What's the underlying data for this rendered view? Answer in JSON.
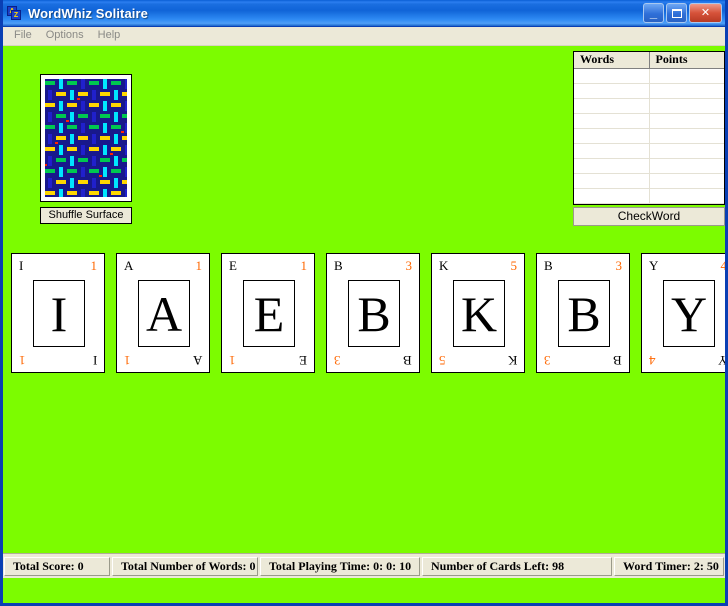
{
  "window": {
    "title": "WordWhiz Solitaire",
    "app_icon": "az-sort-icon",
    "icon_letter_top": "A",
    "icon_letter_bottom": "Z",
    "minimize_label": "_",
    "maximize_label": "",
    "close_label": "✕",
    "background_color": "#7cfc00",
    "titlebar_color": "#1064d8"
  },
  "menu": {
    "items": [
      {
        "label": "File"
      },
      {
        "label": "Options"
      },
      {
        "label": "Help"
      }
    ]
  },
  "deck": {
    "shuffle_label": "Shuffle Surface",
    "back_colors": [
      "#18188c",
      "#ffd700",
      "#00c850",
      "#00e5ff",
      "#2020cc",
      "#ff2200"
    ]
  },
  "wordlist": {
    "columns": [
      "Words",
      "Points"
    ],
    "rows": [
      {
        "word": "",
        "points": ""
      },
      {
        "word": "",
        "points": ""
      },
      {
        "word": "",
        "points": ""
      },
      {
        "word": "",
        "points": ""
      },
      {
        "word": "",
        "points": ""
      },
      {
        "word": "",
        "points": ""
      },
      {
        "word": "",
        "points": ""
      },
      {
        "word": "",
        "points": ""
      },
      {
        "word": "",
        "points": ""
      }
    ],
    "check_label": "CheckWord"
  },
  "cards": [
    {
      "letter": "I",
      "points": "1"
    },
    {
      "letter": "A",
      "points": "1"
    },
    {
      "letter": "E",
      "points": "1"
    },
    {
      "letter": "B",
      "points": "3"
    },
    {
      "letter": "K",
      "points": "5"
    },
    {
      "letter": "B",
      "points": "3"
    },
    {
      "letter": "Y",
      "points": "4"
    }
  ],
  "status": {
    "total_score": "Total Score:  0",
    "total_words": "Total Number of Words:  0",
    "playing_time": "Total Playing Time:  0: 0: 10",
    "cards_left": "Number of Cards Left:  98",
    "word_timer": "Word Timer:  2: 50"
  }
}
